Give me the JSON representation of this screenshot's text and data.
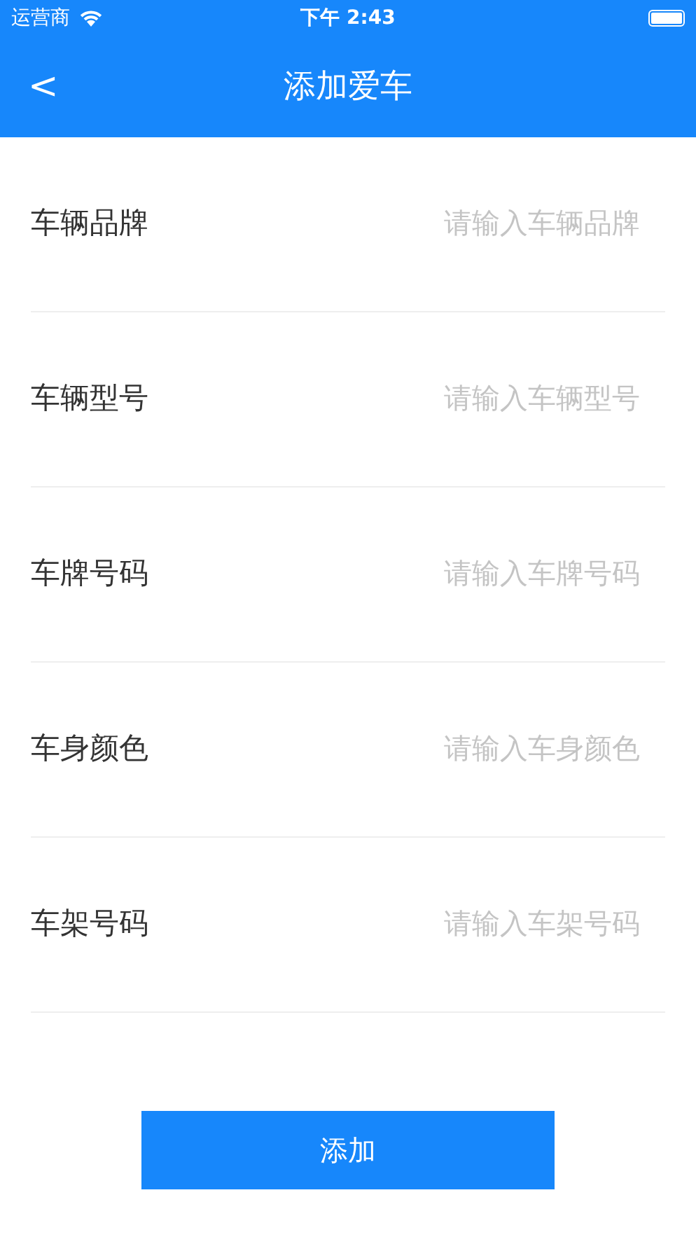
{
  "status_bar": {
    "carrier": "运营商",
    "time": "下午 2:43"
  },
  "nav": {
    "back": "<",
    "title": "添加爱车"
  },
  "fields": [
    {
      "label": "车辆品牌",
      "placeholder": "请输入车辆品牌"
    },
    {
      "label": "车辆型号",
      "placeholder": "请输入车辆型号"
    },
    {
      "label": "车牌号码",
      "placeholder": "请输入车牌号码"
    },
    {
      "label": "车身颜色",
      "placeholder": "请输入车身颜色"
    },
    {
      "label": "车架号码",
      "placeholder": "请输入车架号码"
    }
  ],
  "submit": "添加"
}
